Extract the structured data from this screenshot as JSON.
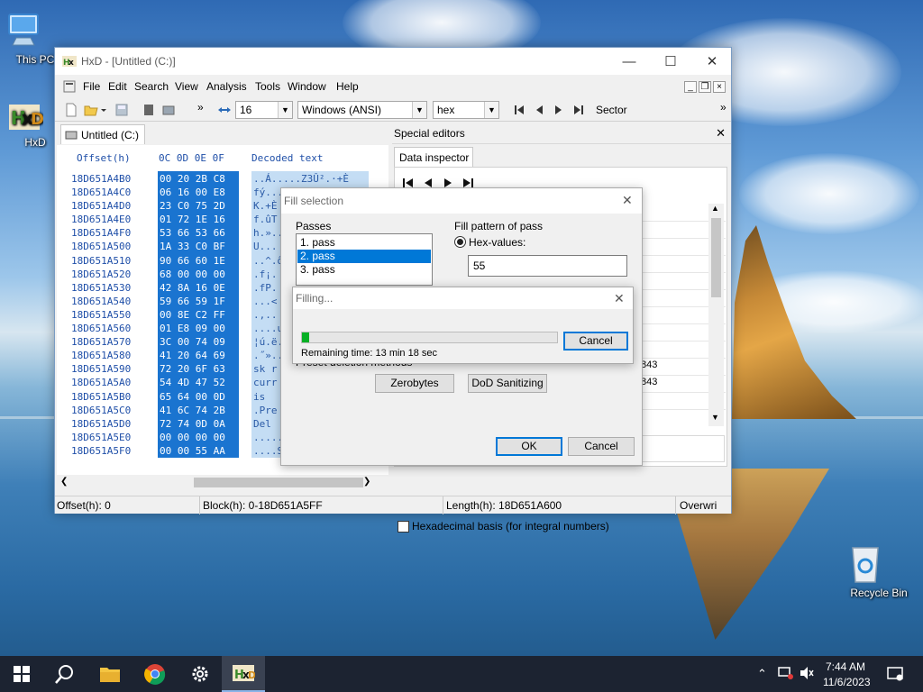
{
  "desktop": {
    "icons": [
      {
        "label": "This PC"
      },
      {
        "label": "HxD"
      },
      {
        "label": "Recycle Bin"
      }
    ]
  },
  "window": {
    "title": "HxD - [Untitled (C:)]",
    "menu": [
      "File",
      "Edit",
      "Search",
      "View",
      "Analysis",
      "Tools",
      "Window",
      "Help"
    ],
    "toolbar": {
      "bytes_per_row": "16",
      "charset": "Windows (ANSI)",
      "offset_base": "hex",
      "section": "Sector",
      "overflow": "»"
    },
    "doc_tab": "Untitled (C:)",
    "hex": {
      "offset_header": "Offset(h)",
      "column_header": "0C 0D 0E 0F",
      "decoded_header": "Decoded text",
      "rows": [
        {
          "offset": "18D651A4B0",
          "hex": "00 20 2B C8",
          "text": "..Á.....Z3Û².·+È"
        },
        {
          "offset": "18D651A4C0",
          "hex": "06 16 00 E8",
          "text": "fý..."
        },
        {
          "offset": "18D651A4D0",
          "hex": "23 C0 75 2D",
          "text": "K.+È"
        },
        {
          "offset": "18D651A4E0",
          "hex": "01 72 1E 16",
          "text": "f.ûT"
        },
        {
          "offset": "18D651A4F0",
          "hex": "53 66 53 66",
          "text": "h.».."
        },
        {
          "offset": "18D651A500",
          "hex": "1A 33 C0 BF",
          "text": "U..."
        },
        {
          "offset": "18D651A510",
          "hex": "90 66 60 1E",
          "text": "..^.ô"
        },
        {
          "offset": "18D651A520",
          "hex": "68 00 00 00",
          "text": ".f¡."
        },
        {
          "offset": "18D651A530",
          "hex": "42 8A 16 0E",
          "text": ".fP."
        },
        {
          "offset": "18D651A540",
          "hex": "59 66 59 1F",
          "text": "...<"
        },
        {
          "offset": "18D651A550",
          "hex": "00 8E C2 FF",
          "text": ".,.."
        },
        {
          "offset": "18D651A560",
          "hex": "01 E8 09 00",
          "text": "....u"
        },
        {
          "offset": "18D651A570",
          "hex": "3C 00 74 09",
          "text": "¦ú.ë."
        },
        {
          "offset": "18D651A580",
          "hex": "41 20 64 69",
          "text": ".˝».."
        },
        {
          "offset": "18D651A590",
          "hex": "72 20 6F 63",
          "text": "sk r"
        },
        {
          "offset": "18D651A5A0",
          "hex": "54 4D 47 52",
          "text": "curr"
        },
        {
          "offset": "18D651A5B0",
          "hex": "65 64 00 0D",
          "text": " is"
        },
        {
          "offset": "18D651A5C0",
          "hex": "41 6C 74 2B",
          "text": ".Pre"
        },
        {
          "offset": "18D651A5D0",
          "hex": "72 74 0D 0A",
          "text": "Del"
        },
        {
          "offset": "18D651A5E0",
          "hex": "00 00 00 00",
          "text": "......."
        },
        {
          "offset": "18D651A5F0",
          "hex": "00 00 55 AA",
          "text": "....S.§.....ÿ.."
        }
      ]
    },
    "special": {
      "header": "Special editors",
      "tab": "Data inspector",
      "values": [
        "843",
        "843"
      ],
      "checkbox_label": "Hexadecimal basis (for integral numbers)"
    },
    "status": {
      "offset": "Offset(h): 0",
      "block": "Block(h): 0-18D651A5FF",
      "length": "Length(h): 18D651A600",
      "mode": "Overwri"
    }
  },
  "fill_dialog": {
    "title": "Fill selection",
    "passes_label": "Passes",
    "passes": [
      "1. pass",
      "2. pass",
      "3. pass"
    ],
    "selected_pass": 1,
    "pattern_label": "Fill pattern of pass",
    "hex_values_label": "Hex-values:",
    "hex_value": "55",
    "preset_label": "Preset deletion methods",
    "zerobytes": "Zerobytes",
    "dod": "DoD Sanitizing",
    "ok": "OK",
    "cancel": "Cancel"
  },
  "filling_dialog": {
    "title": "Filling...",
    "remaining": "Remaining time: 13 min 18 sec",
    "cancel": "Cancel",
    "progress": 0.03
  },
  "taskbar": {
    "apps": [
      "start-icon",
      "search-icon",
      "file-explorer-icon",
      "chrome-icon",
      "settings-icon",
      "hxd-icon"
    ],
    "time": "7:44 AM",
    "date": "11/6/2023"
  }
}
